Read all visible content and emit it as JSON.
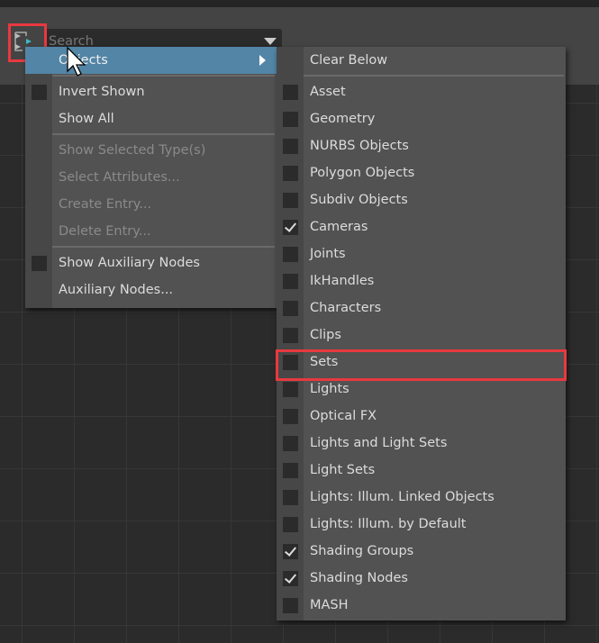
{
  "search": {
    "placeholder": "Search"
  },
  "left_menu": {
    "items": [
      {
        "label": "Objects",
        "type": "submenu",
        "highlighted": true
      },
      {
        "type": "separator"
      },
      {
        "label": "Invert Shown",
        "type": "checkbox",
        "checked": false
      },
      {
        "label": "Show All",
        "type": "item"
      },
      {
        "type": "separator"
      },
      {
        "label": "Show Selected Type(s)",
        "type": "item",
        "disabled": true
      },
      {
        "label": "Select Attributes...",
        "type": "item",
        "disabled": true
      },
      {
        "label": "Create Entry...",
        "type": "item",
        "disabled": true
      },
      {
        "label": "Delete Entry...",
        "type": "item",
        "disabled": true
      },
      {
        "type": "separator"
      },
      {
        "label": "Show Auxiliary Nodes",
        "type": "checkbox",
        "checked": false
      },
      {
        "label": "Auxiliary Nodes...",
        "type": "item"
      }
    ]
  },
  "sub_menu": {
    "items": [
      {
        "label": "Clear Below",
        "type": "item"
      },
      {
        "type": "separator"
      },
      {
        "label": "Asset",
        "type": "checkbox",
        "checked": false
      },
      {
        "label": "Geometry",
        "type": "checkbox",
        "checked": false
      },
      {
        "label": "NURBS Objects",
        "type": "checkbox",
        "checked": false
      },
      {
        "label": "Polygon Objects",
        "type": "checkbox",
        "checked": false
      },
      {
        "label": "Subdiv Objects",
        "type": "checkbox",
        "checked": false
      },
      {
        "label": "Cameras",
        "type": "checkbox",
        "checked": true
      },
      {
        "label": "Joints",
        "type": "checkbox",
        "checked": false
      },
      {
        "label": "IkHandles",
        "type": "checkbox",
        "checked": false
      },
      {
        "label": "Characters",
        "type": "checkbox",
        "checked": false
      },
      {
        "label": "Clips",
        "type": "checkbox",
        "checked": false
      },
      {
        "label": "Sets",
        "type": "checkbox",
        "checked": false,
        "annotated": true
      },
      {
        "label": "Lights",
        "type": "checkbox",
        "checked": false
      },
      {
        "label": "Optical FX",
        "type": "checkbox",
        "checked": false
      },
      {
        "label": "Lights and Light Sets",
        "type": "checkbox",
        "checked": false
      },
      {
        "label": "Light Sets",
        "type": "checkbox",
        "checked": false
      },
      {
        "label": "Lights: Illum. Linked Objects",
        "type": "checkbox",
        "checked": false
      },
      {
        "label": "Lights: Illum. by Default",
        "type": "checkbox",
        "checked": false
      },
      {
        "label": "Shading Groups",
        "type": "checkbox",
        "checked": true
      },
      {
        "label": "Shading Nodes",
        "type": "checkbox",
        "checked": true
      },
      {
        "label": "MASH",
        "type": "checkbox",
        "checked": false
      }
    ]
  },
  "colors": {
    "highlight": "#5285a6",
    "annotation": "#e8393f",
    "menu_bg": "#525252"
  }
}
